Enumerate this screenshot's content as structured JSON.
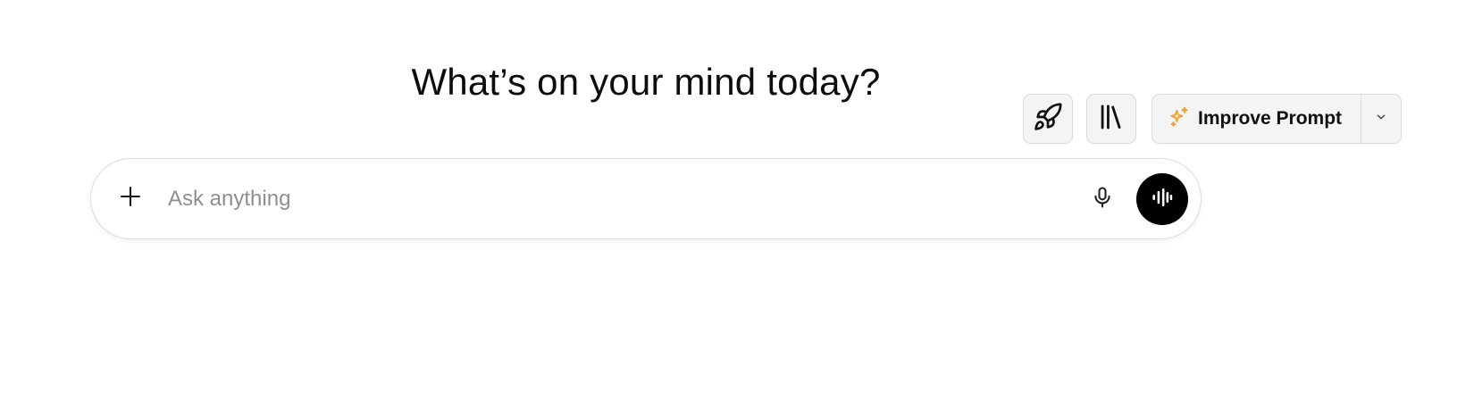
{
  "headline": "What’s on your mind today?",
  "toolbar": {
    "rocket_icon": "rocket-icon",
    "library_icon": "library-books-icon",
    "improve_prompt_label": "Improve Prompt",
    "sparkle_icon": "sparkle-icon",
    "sparkle_color": "#F0A23B",
    "chevron_icon": "chevron-down-icon"
  },
  "composer": {
    "placeholder": "Ask anything",
    "value": "",
    "plus_icon": "plus-icon",
    "mic_icon": "microphone-icon",
    "voice_icon": "voice-waveform-icon",
    "voice_button_color": "#000000"
  }
}
